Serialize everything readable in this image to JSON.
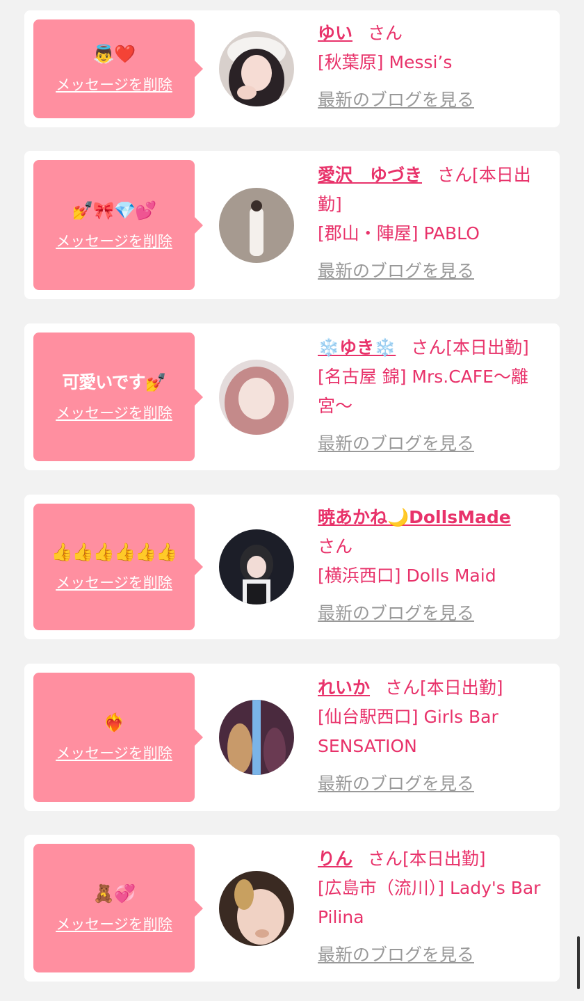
{
  "theme": {
    "accent": "#e8326a",
    "bubble": "#ff8fa0",
    "link_muted": "#999999",
    "background": "#f2f2f2"
  },
  "cards": [
    {
      "message": "👼❤️",
      "delete_label": "メッセージを削除",
      "name": "ゆい",
      "san": "さん",
      "status": "",
      "shop": "[秋葉原] Messi’s",
      "blog_label": "最新のブログを見る"
    },
    {
      "message": "💅🎀💎💕",
      "delete_label": "メッセージを削除",
      "name": "愛沢　ゆづき",
      "san": "さん",
      "status": "[本日出勤]",
      "shop": "[郡山・陣屋] PABLO",
      "blog_label": "最新のブログを見る"
    },
    {
      "message": "可愛いです💅",
      "delete_label": "メッセージを削除",
      "name": "❄️ゆき❄️",
      "san": "さん",
      "status": "[本日出勤]",
      "shop": "[名古屋 錦] Mrs.CAFE〜離宮〜",
      "blog_label": "最新のブログを見る"
    },
    {
      "message": "👍👍👍👍👍👍",
      "delete_label": "メッセージを削除",
      "name": "暁あかね🌙DollsMade",
      "san": "さん",
      "status": "",
      "shop": "[横浜西口] Dolls Maid",
      "blog_label": "最新のブログを見る"
    },
    {
      "message": "❤️‍🔥",
      "delete_label": "メッセージを削除",
      "name": "れいか",
      "san": "さん",
      "status": "[本日出勤]",
      "shop": "[仙台駅西口] Girls Bar SENSATION",
      "blog_label": "最新のブログを見る"
    },
    {
      "message": "🧸💞",
      "delete_label": "メッセージを削除",
      "name": "りん",
      "san": "さん",
      "status": "[本日出勤]",
      "shop": "[広島市（流川）] Lady's Bar Pilina",
      "blog_label": "最新のブログを見る"
    }
  ]
}
